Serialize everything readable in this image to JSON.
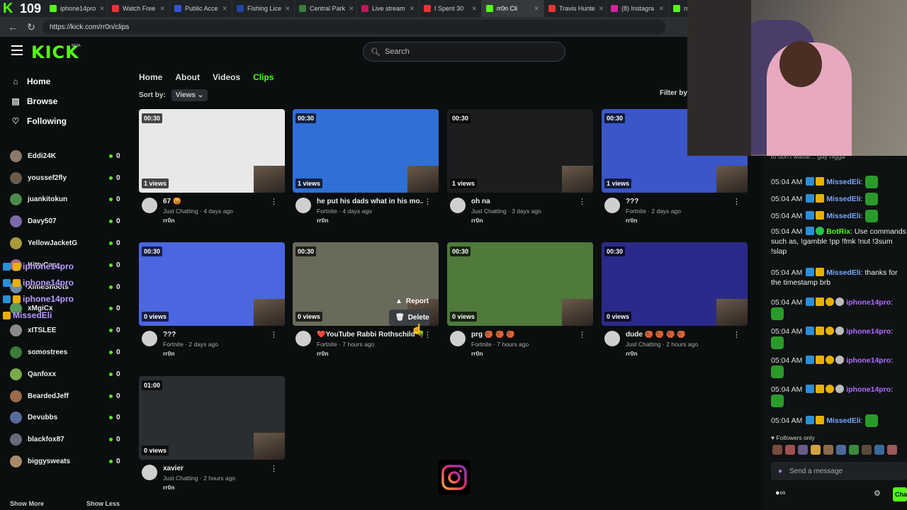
{
  "browser": {
    "tab_count": "109",
    "tabs": [
      {
        "label": "iphone14pro",
        "color": "#53fc18"
      },
      {
        "label": "Watch Free",
        "color": "#e33"
      },
      {
        "label": "Public Acce",
        "color": "#3355dd"
      },
      {
        "label": "Fishing Lice",
        "color": "#2244aa"
      },
      {
        "label": "Central Park",
        "color": "#3a7a3a"
      },
      {
        "label": "Live stream",
        "color": "#c2185b"
      },
      {
        "label": "I Spent 30",
        "color": "#e33"
      },
      {
        "label": "rr0n Cli",
        "color": "#53fc18"
      },
      {
        "label": "Travis Hunte",
        "color": "#e33"
      },
      {
        "label": "(8) Instagra",
        "color": "#d6249f"
      },
      {
        "label": "rr0n cli",
        "color": "#53fc18"
      }
    ],
    "url": "https://kick.com/rr0n/clips"
  },
  "header": {
    "logo": "KICK",
    "beta": "BETA",
    "search_placeholder": "Search"
  },
  "sidebar": {
    "nav": [
      {
        "label": "Home",
        "icon": "home-icon"
      },
      {
        "label": "Browse",
        "icon": "browse-icon"
      },
      {
        "label": "Following",
        "icon": "heart-icon"
      }
    ],
    "channels": [
      {
        "name": "Eddi24K",
        "count": "0",
        "color": "#8a7a6a"
      },
      {
        "name": "youssef2fly",
        "count": "0",
        "color": "#6a5a4a"
      },
      {
        "name": "juankitokun",
        "count": "0",
        "color": "#4a8a4a"
      },
      {
        "name": "Davy507",
        "count": "0",
        "color": "#7a6aaa"
      },
      {
        "name": "YellowJacketG",
        "count": "0",
        "color": "#aa9a3a"
      },
      {
        "name": "KittyCass",
        "count": "0",
        "color": "#aa6a8a"
      },
      {
        "name": "XimeShoots",
        "count": "0",
        "color": "#6a8aaa"
      },
      {
        "name": "xMgiCx",
        "count": "0",
        "color": "#5a9a5a"
      },
      {
        "name": "xITSLEE",
        "count": "0",
        "color": "#8a8a8a"
      },
      {
        "name": "somostrees",
        "count": "0",
        "color": "#3a7a3a"
      },
      {
        "name": "Qanfoxx",
        "count": "0",
        "color": "#7aaa4a"
      },
      {
        "name": "BeardedJeff",
        "count": "0",
        "color": "#9a6a4a"
      },
      {
        "name": "Devubbs",
        "count": "0",
        "color": "#5a6a9a"
      },
      {
        "name": "blackfox87",
        "count": "0",
        "color": "#6a6a7a"
      },
      {
        "name": "biggysweats",
        "count": "0",
        "color": "#aa8a6a"
      }
    ],
    "show_more": "Show More",
    "show_less": "Show Less",
    "overlay_alerts": [
      "iphone14pro",
      "iphone14pro",
      "iphone14pro",
      "MissedEli"
    ]
  },
  "page": {
    "tabs": [
      "Home",
      "About",
      "Videos",
      "Clips"
    ],
    "active_tab": "Clips",
    "sort_label": "Sort by:",
    "sort_value": "Views",
    "filter_label": "Filter by:"
  },
  "clips": [
    {
      "duration": "00:30",
      "views": "1 views",
      "title": "67 😡",
      "category": "Just Chatting",
      "age": "4 days ago",
      "channel": "rr0n",
      "bg": "#e8e8e8"
    },
    {
      "duration": "00:30",
      "views": "1 views",
      "title": "he put his dads what in his mo...",
      "category": "Fortnite",
      "age": "4 days ago",
      "channel": "rr0n",
      "bg": "#2f6fd6"
    },
    {
      "duration": "00:30",
      "views": "1 views",
      "title": "oh na",
      "category": "Just Chatting",
      "age": "3 days ago",
      "channel": "rr0n",
      "bg": "#1b1d1f"
    },
    {
      "duration": "00:30",
      "views": "1 views",
      "title": "???",
      "category": "Fortnite",
      "age": "2 days ago",
      "channel": "rr0n",
      "bg": "#3a56c8"
    },
    {
      "duration": "00:30",
      "views": "0 views",
      "title": "???",
      "category": "Fortnite",
      "age": "2 days ago",
      "channel": "rr0n",
      "bg": "#4a66e0"
    },
    {
      "duration": "00:30",
      "views": "0 views",
      "title": "❤️YouTube Rabbi Rothschild 🌳...",
      "category": "Fortnite",
      "age": "7 hours ago",
      "channel": "rr0n",
      "bg": "#6a6a5a"
    },
    {
      "duration": "00:30",
      "views": "0 views",
      "title": "prg 🏀 🏀 🏀",
      "category": "Fortnite",
      "age": "7 hours ago",
      "channel": "rr0n",
      "bg": "#4f7a3a"
    },
    {
      "duration": "00:30",
      "views": "0 views",
      "title": "dude 🏀 🏀 🏀 🏀",
      "category": "Just Chatting",
      "age": "2 hours ago",
      "channel": "rr0n",
      "bg": "#2a2a8a"
    },
    {
      "duration": "01:00",
      "views": "0 views",
      "title": "xavier",
      "category": "Just Chatting",
      "age": "2 hours ago",
      "channel": "rr0n",
      "bg": "#2a2e30"
    }
  ],
  "context_menu": {
    "report": "Report",
    "delete": "Delete"
  },
  "chat": {
    "top_partial": "to don't waste... gay nigga",
    "messages": [
      {
        "time": "05:04 AM",
        "user": "MissedEli",
        "text": "",
        "user_color": "#7aa6ff"
      },
      {
        "time": "05:04 AM",
        "user": "MissedEli",
        "text": "",
        "user_color": "#7aa6ff"
      },
      {
        "time": "05:04 AM",
        "user": "MissedEli",
        "text": "",
        "user_color": "#7aa6ff"
      },
      {
        "time": "05:04 AM",
        "user": "BotRix",
        "text": "Use commands such as, !gamble !pp !fmk !nut !3sum !slap",
        "user_color": "#53fc18"
      },
      {
        "time": "05:04 AM",
        "user": "MissedEli",
        "text": "thanks for the timestamp brb",
        "user_color": "#7aa6ff"
      },
      {
        "time": "05:04 AM",
        "user": "iphone14pro",
        "text": "",
        "user_color": "#b06cff"
      },
      {
        "time": "05:04 AM",
        "user": "iphone14pro",
        "text": "",
        "user_color": "#b06cff"
      },
      {
        "time": "05:04 AM",
        "user": "iphone14pro",
        "text": "",
        "user_color": "#b06cff"
      },
      {
        "time": "05:04 AM",
        "user": "iphone14pro",
        "text": "",
        "user_color": "#b06cff"
      },
      {
        "time": "05:04 AM",
        "user": "MissedEli",
        "text": "",
        "user_color": "#7aa6ff"
      }
    ],
    "followers_only": "Followers only",
    "send_placeholder": "Send a message",
    "chat_button": "Chat"
  },
  "colors": {
    "accent": "#53fc18",
    "background": "#0b0e0f"
  }
}
